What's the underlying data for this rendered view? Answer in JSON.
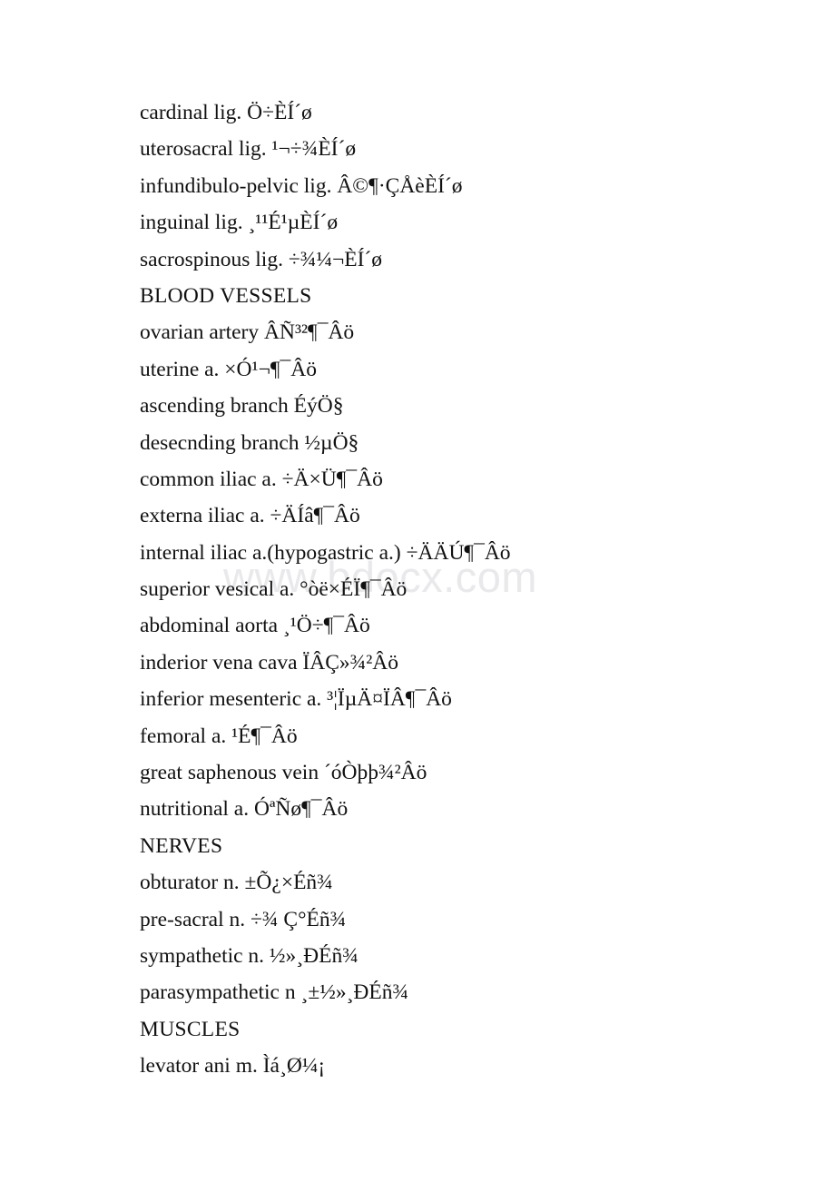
{
  "document": {
    "watermark": "www.bdocx.com",
    "lines": [
      {
        "id": "cardinal-ligament",
        "type": "entry",
        "text": "cardinal lig. Ö÷ÈÍ´ø"
      },
      {
        "id": "uterosacral-ligament",
        "type": "entry",
        "text": "uterosacral lig. ¹¬÷¾ÈÍ´ø"
      },
      {
        "id": "infundibulo-pelvic-ligament",
        "type": "entry",
        "text": "infundibulo-pelvic lig. Â©¶·ÇÅèÈÍ´ø"
      },
      {
        "id": "inguinal-ligament",
        "type": "entry",
        "text": "inguinal lig. ¸¹¹É¹µÈÍ´ø"
      },
      {
        "id": "sacrospinous-ligament",
        "type": "entry",
        "text": "sacrospinous lig. ÷¾¼¬ÈÍ´ø"
      },
      {
        "id": "blood-vessels-heading",
        "type": "heading",
        "text": "BLOOD VESSELS"
      },
      {
        "id": "ovarian-artery",
        "type": "entry",
        "text": "ovarian artery ÂÑ³²¶¯Âö"
      },
      {
        "id": "uterine-artery",
        "type": "entry",
        "text": "uterine a. ×Ó¹¬¶¯Âö"
      },
      {
        "id": "ascending-branch",
        "type": "entry",
        "text": "ascending branch ÉýÖ§"
      },
      {
        "id": "descending-branch",
        "type": "entry",
        "text": "desecnding branch ½µÖ§"
      },
      {
        "id": "common-iliac-artery",
        "type": "entry",
        "text": "common iliac a. ÷Ä×Ü¶¯Âö"
      },
      {
        "id": "external-iliac-artery",
        "type": "entry",
        "text": "externa iliac a. ÷ÄÍâ¶¯Âö"
      },
      {
        "id": "internal-iliac-artery",
        "type": "entry",
        "text": "internal iliac a.(hypogastric a.) ÷ÄÄÚ¶¯Âö"
      },
      {
        "id": "superior-vesical-artery",
        "type": "entry",
        "text": "superior vesical a. °òë×ÉÏ¶¯Âö"
      },
      {
        "id": "abdominal-aorta",
        "type": "entry",
        "text": "abdominal aorta ¸¹Ö÷¶¯Âö"
      },
      {
        "id": "inferior-vena-cava",
        "type": "entry",
        "text": "inderior vena cava ÏÂÇ»¾²Âö"
      },
      {
        "id": "inferior-mesenteric-artery",
        "type": "entry",
        "text": "inferior mesenteric a. ³¦ÏµÄ¤ÏÂ¶¯Âö"
      },
      {
        "id": "femoral-artery",
        "type": "entry",
        "text": "femoral a. ¹É¶¯Âö"
      },
      {
        "id": "great-saphenous-vein",
        "type": "entry",
        "text": "great saphenous vein ´óÒþþ¾²Âö"
      },
      {
        "id": "nutritional-artery",
        "type": "entry",
        "text": "nutritional a. ÓªÑø¶¯Âö"
      },
      {
        "id": "nerves-heading",
        "type": "heading",
        "text": "NERVES"
      },
      {
        "id": "obturator-nerve",
        "type": "entry",
        "text": "obturator n. ±Õ¿×Éñ¾­"
      },
      {
        "id": "pre-sacral-nerve",
        "type": "entry",
        "text": "pre-sacral n. ÷¾ Ç°Éñ¾­"
      },
      {
        "id": "sympathetic-nerve",
        "type": "entry",
        "text": "sympathetic n. ½»¸ÐÉñ¾­"
      },
      {
        "id": "parasympathetic-nerve",
        "type": "entry",
        "text": "parasympathetic n ¸±½»¸ÐÉñ¾­"
      },
      {
        "id": "muscles-heading",
        "type": "heading",
        "text": "MUSCLES"
      },
      {
        "id": "levator-ani-muscle",
        "type": "entry",
        "text": "levator ani m. Ìá¸Ø¼¡"
      }
    ]
  }
}
